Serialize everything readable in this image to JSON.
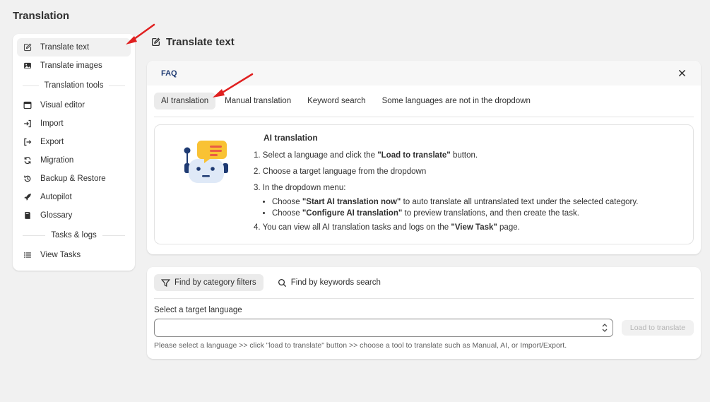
{
  "page": {
    "title": "Translation"
  },
  "sidebar": {
    "items_top": [
      {
        "label": "Translate text",
        "icon": "edit-icon",
        "active": true
      },
      {
        "label": "Translate images",
        "icon": "image-icon",
        "active": false
      }
    ],
    "section_tools": "Translation tools",
    "items_tools": [
      {
        "label": "Visual editor",
        "icon": "visual-editor-icon"
      },
      {
        "label": "Import",
        "icon": "import-icon"
      },
      {
        "label": "Export",
        "icon": "export-icon"
      },
      {
        "label": "Migration",
        "icon": "refresh-icon"
      },
      {
        "label": "Backup & Restore",
        "icon": "backup-icon"
      },
      {
        "label": "Autopilot",
        "icon": "rocket-icon"
      },
      {
        "label": "Glossary",
        "icon": "book-icon"
      }
    ],
    "section_tasks": "Tasks & logs",
    "items_tasks": [
      {
        "label": "View Tasks",
        "icon": "list-icon"
      }
    ]
  },
  "main": {
    "title": "Translate text",
    "faq": {
      "label": "FAQ",
      "tabs": [
        "AI translation",
        "Manual translation",
        "Keyword search",
        "Some languages are not in the dropdown"
      ],
      "active_tab": 0,
      "heading": "AI translation",
      "steps": {
        "s1_pre": "1. Select a language and click the ",
        "s1_bold": "\"Load to translate\"",
        "s1_post": " button.",
        "s2": "2. Choose a target language from the dropdown",
        "s3": "3. In the dropdown menu:",
        "b1_pre": "Choose ",
        "b1_bold": "\"Start AI translation now\"",
        "b1_post": " to auto translate all untranslated text under the selected category.",
        "b2_pre": "Choose ",
        "b2_bold": "\"Configure AI translation\"",
        "b2_post": " to preview translations, and then create the task.",
        "s4_pre": "4. You can view all AI translation tasks and logs on the ",
        "s4_bold": "\"View Task\"",
        "s4_post": " page."
      }
    },
    "load": {
      "filter_category": "Find by category filters",
      "filter_keywords": "Find by keywords search",
      "field_label": "Select a target language",
      "select_value": "",
      "button_label": "Load to translate",
      "help": "Please select a language >> click \"load to translate\" button >> choose a tool to translate such as Manual, AI, or Import/Export."
    }
  },
  "colors": {
    "accent_link": "#1f3b73",
    "arrow": "#e02020"
  }
}
